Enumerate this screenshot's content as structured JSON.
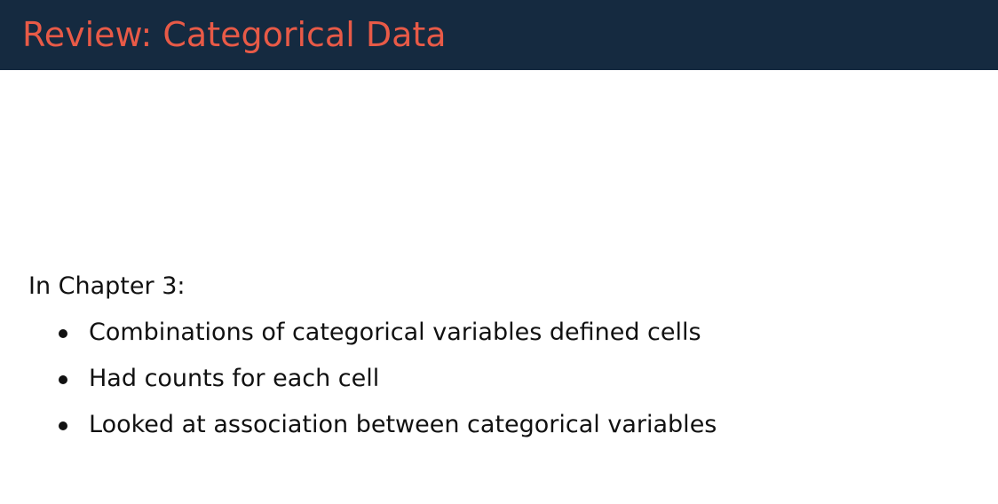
{
  "slide": {
    "title": "Review: Categorical Data",
    "intro": "In Chapter 3:",
    "bullets": [
      "Combinations of categorical variables defined cells",
      "Had counts for each cell",
      "Looked at association between categorical variables"
    ]
  },
  "colors": {
    "header_background": "#152a40",
    "title_text": "#e85a47",
    "body_text": "#111111"
  }
}
